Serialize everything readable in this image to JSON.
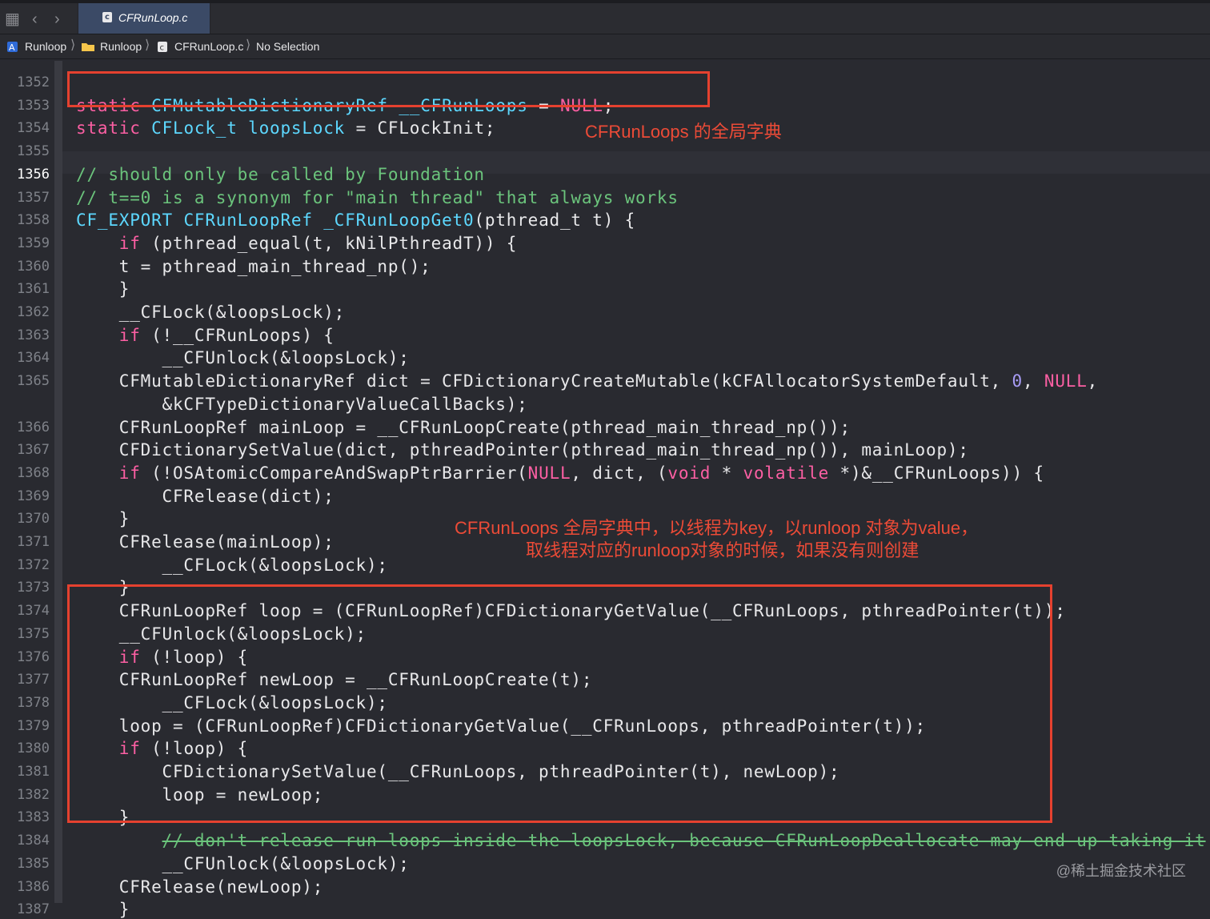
{
  "tab": {
    "title": "CFRunLoop.c"
  },
  "breadcrumb": [
    "Runloop",
    "Runloop",
    "CFRunLoop.c",
    "No Selection"
  ],
  "annotations": {
    "global_dict": "CFRunLoops 的全局字典",
    "explain_line1": "CFRunLoops 全局字典中，以线程为key，以runloop 对象为value，",
    "explain_line2": "取线程对应的runloop对象的时候，如果没有则创建"
  },
  "watermark": "@稀土掘金技术社区",
  "current_line": "1356",
  "lines": [
    {
      "n": "1352",
      "segs": []
    },
    {
      "n": "1353",
      "segs": [
        [
          "kw",
          "static"
        ],
        [
          "",
          ""
        ],
        [
          "ty",
          "CFMutableDictionaryRef"
        ],
        [
          "",
          ""
        ],
        [
          "ty",
          "__CFRunLoops"
        ],
        [
          "",
          " = "
        ],
        [
          "kw",
          "NULL"
        ],
        [
          "",
          ";"
        ]
      ]
    },
    {
      "n": "1354",
      "segs": [
        [
          "kw",
          "static"
        ],
        [
          "",
          ""
        ],
        [
          "ty",
          "CFLock_t"
        ],
        [
          "",
          ""
        ],
        [
          "ty",
          "loopsLock"
        ],
        [
          "",
          " = CFLockInit;"
        ]
      ]
    },
    {
      "n": "1355",
      "segs": []
    },
    {
      "n": "1356",
      "segs": [
        [
          "cm",
          "// should only be called by Foundation"
        ]
      ]
    },
    {
      "n": "1357",
      "segs": [
        [
          "cm",
          "// t==0 is a synonym for \"main thread\" that always works"
        ]
      ]
    },
    {
      "n": "1358",
      "segs": [
        [
          "ty",
          "CF_EXPORT"
        ],
        [
          "",
          ""
        ],
        [
          "ty",
          "CFRunLoopRef"
        ],
        [
          "",
          ""
        ],
        [
          "ty",
          "_CFRunLoopGet0"
        ],
        [
          "",
          "(pthread_t t) {"
        ]
      ]
    },
    {
      "n": "1359",
      "segs": [
        [
          "",
          "    "
        ],
        [
          "kw",
          "if"
        ],
        [
          "",
          " (pthread_equal(t, kNilPthreadT)) {"
        ]
      ]
    },
    {
      "n": "1360",
      "segs": [
        [
          "",
          "    t = pthread_main_thread_np();"
        ]
      ]
    },
    {
      "n": "1361",
      "segs": [
        [
          "",
          "    }"
        ]
      ]
    },
    {
      "n": "1362",
      "segs": [
        [
          "",
          "    __CFLock(&loopsLock);"
        ]
      ]
    },
    {
      "n": "1363",
      "segs": [
        [
          "",
          "    "
        ],
        [
          "kw",
          "if"
        ],
        [
          "",
          " (!__CFRunLoops) {"
        ]
      ]
    },
    {
      "n": "1364",
      "segs": [
        [
          "",
          "        __CFUnlock(&loopsLock);"
        ]
      ]
    },
    {
      "n": "1365",
      "segs": [
        [
          "",
          "    CFMutableDictionaryRef dict = CFDictionaryCreateMutable(kCFAllocatorSystemDefault, "
        ],
        [
          "nm",
          "0"
        ],
        [
          "",
          ", "
        ],
        [
          "kw",
          "NULL"
        ],
        [
          "",
          ","
        ]
      ]
    },
    {
      "n": "",
      "segs": [
        [
          "",
          "        &kCFTypeDictionaryValueCallBacks);"
        ]
      ]
    },
    {
      "n": "1366",
      "segs": [
        [
          "",
          "    CFRunLoopRef mainLoop = __CFRunLoopCreate(pthread_main_thread_np());"
        ]
      ]
    },
    {
      "n": "1367",
      "segs": [
        [
          "",
          "    CFDictionarySetValue(dict, pthreadPointer(pthread_main_thread_np()), mainLoop);"
        ]
      ]
    },
    {
      "n": "1368",
      "segs": [
        [
          "",
          "    "
        ],
        [
          "kw",
          "if"
        ],
        [
          "",
          " (!OSAtomicCompareAndSwapPtrBarrier("
        ],
        [
          "kw",
          "NULL"
        ],
        [
          "",
          ", dict, ("
        ],
        [
          "kw",
          "void"
        ],
        [
          "",
          " * "
        ],
        [
          "kw",
          "volatile"
        ],
        [
          "",
          " *)&__CFRunLoops)) {"
        ]
      ]
    },
    {
      "n": "1369",
      "segs": [
        [
          "",
          "        CFRelease(dict);"
        ]
      ]
    },
    {
      "n": "1370",
      "segs": [
        [
          "",
          "    }"
        ]
      ]
    },
    {
      "n": "1371",
      "segs": [
        [
          "",
          "    CFRelease(mainLoop);"
        ]
      ]
    },
    {
      "n": "1372",
      "segs": [
        [
          "",
          "        __CFLock(&loopsLock);"
        ]
      ]
    },
    {
      "n": "1373",
      "segs": [
        [
          "",
          "    }"
        ]
      ]
    },
    {
      "n": "1374",
      "segs": [
        [
          "",
          "    CFRunLoopRef loop = (CFRunLoopRef)CFDictionaryGetValue(__CFRunLoops, pthreadPointer(t));"
        ]
      ]
    },
    {
      "n": "1375",
      "segs": [
        [
          "",
          "    __CFUnlock(&loopsLock);"
        ]
      ]
    },
    {
      "n": "1376",
      "segs": [
        [
          "",
          "    "
        ],
        [
          "kw",
          "if"
        ],
        [
          "",
          " (!loop) {"
        ]
      ]
    },
    {
      "n": "1377",
      "segs": [
        [
          "",
          "    CFRunLoopRef newLoop = __CFRunLoopCreate(t);"
        ]
      ]
    },
    {
      "n": "1378",
      "segs": [
        [
          "",
          "        __CFLock(&loopsLock);"
        ]
      ]
    },
    {
      "n": "1379",
      "segs": [
        [
          "",
          "    loop = (CFRunLoopRef)CFDictionaryGetValue(__CFRunLoops, pthreadPointer(t));"
        ]
      ]
    },
    {
      "n": "1380",
      "segs": [
        [
          "",
          "    "
        ],
        [
          "kw",
          "if"
        ],
        [
          "",
          " (!loop) {"
        ]
      ]
    },
    {
      "n": "1381",
      "segs": [
        [
          "",
          "        CFDictionarySetValue(__CFRunLoops, pthreadPointer(t), newLoop);"
        ]
      ]
    },
    {
      "n": "1382",
      "segs": [
        [
          "",
          "        loop = newLoop;"
        ]
      ]
    },
    {
      "n": "1383",
      "segs": [
        [
          "",
          "    }"
        ]
      ]
    },
    {
      "n": "1384",
      "segs": [
        [
          "",
          "        "
        ],
        [
          "cm strk",
          "// don't release run loops inside the loopsLock, because CFRunLoopDeallocate may end up taking it"
        ]
      ]
    },
    {
      "n": "1385",
      "segs": [
        [
          "",
          "        __CFUnlock(&loopsLock);"
        ]
      ]
    },
    {
      "n": "1386",
      "segs": [
        [
          "",
          "    CFRelease(newLoop);"
        ]
      ]
    },
    {
      "n": "1387",
      "segs": [
        [
          "",
          "    }"
        ]
      ]
    }
  ]
}
